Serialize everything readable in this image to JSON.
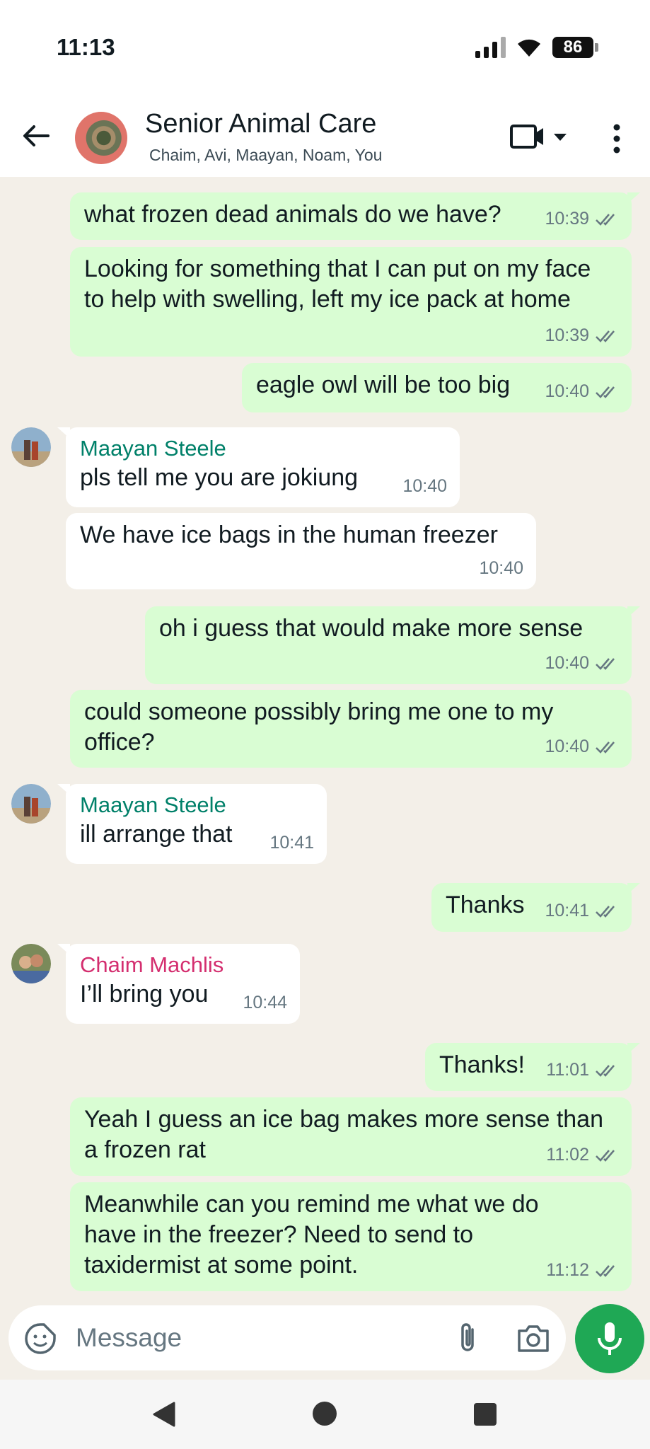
{
  "status_bar": {
    "time": "11:13",
    "battery": "86"
  },
  "header": {
    "title": "Senior Animal Care",
    "members": "Chaim, Avi, Maayan, Noam, You"
  },
  "messages": [
    {
      "direction": "out",
      "text": "what frozen dead animals do we have?",
      "time": "10:39"
    },
    {
      "direction": "out",
      "text": "Looking for something that I can put on my face to help with swelling, left my ice pack at home",
      "time": "10:39"
    },
    {
      "direction": "out",
      "text": "eagle owl will be too big",
      "time": "10:40"
    },
    {
      "direction": "in",
      "sender": "Maayan Steele",
      "text": "pls tell me you are jokiung",
      "time": "10:40"
    },
    {
      "direction": "in",
      "text": "We have ice bags in the human freezer",
      "time": "10:40"
    },
    {
      "direction": "out",
      "text": "oh i guess that would make more sense",
      "time": "10:40"
    },
    {
      "direction": "out",
      "text": "could someone possibly bring me one to my office?",
      "time": "10:40"
    },
    {
      "direction": "in",
      "sender": "Maayan Steele",
      "text": "ill arrange that",
      "time": "10:41"
    },
    {
      "direction": "out",
      "text": "Thanks",
      "time": "10:41"
    },
    {
      "direction": "in",
      "sender": "Chaim Machlis",
      "text": "I’ll bring you",
      "time": "10:44"
    },
    {
      "direction": "out",
      "text": "Thanks!",
      "time": "11:01"
    },
    {
      "direction": "out",
      "text": "Yeah I guess an ice bag makes more sense than a frozen rat",
      "time": "11:02"
    },
    {
      "direction": "out",
      "text": "Meanwhile can you remind me what we do have in the freezer? Need to send to taxidermist at some point.",
      "time": "11:12"
    }
  ],
  "composer": {
    "placeholder": "Message"
  },
  "colors": {
    "outgoing_bubble": "#d9fdd3",
    "incoming_bubble": "#ffffff",
    "chat_background": "#f3efe8",
    "sender_maayan": "#008069",
    "sender_chaim": "#d42e6f",
    "mic_button": "#1fa855",
    "read_ticks": "#667781"
  },
  "icons": [
    "back-arrow-icon",
    "video-call-icon",
    "dropdown-caret-icon",
    "more-options-icon",
    "sticker-icon",
    "attach-icon",
    "camera-icon",
    "mic-icon",
    "nav-back-icon",
    "nav-home-icon",
    "nav-recents-icon"
  ]
}
